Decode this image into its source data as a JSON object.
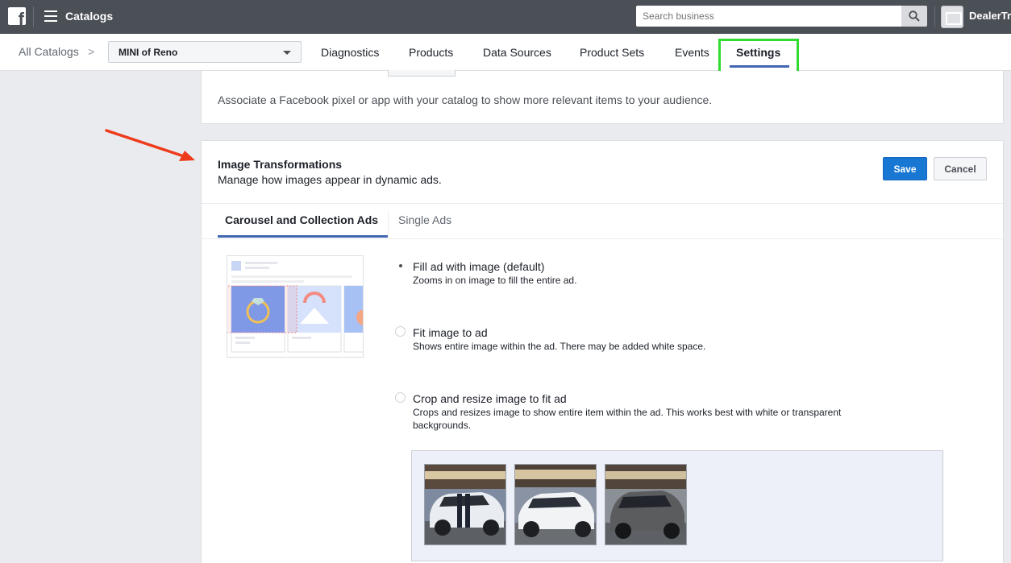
{
  "topbar": {
    "logo_letter": "f",
    "app_title": "Catalogs",
    "search_placeholder": "Search business",
    "business_name": "DealerTre"
  },
  "subnav": {
    "breadcrumb": "All Catalogs",
    "breadcrumb_sep": ">",
    "catalog_selected": "MINI of Reno",
    "tabs": [
      "Diagnostics",
      "Products",
      "Data Sources",
      "Product Sets",
      "Events",
      "Settings"
    ],
    "active_tab": "Settings"
  },
  "pixel_card": {
    "description": "Associate a Facebook pixel or app with your catalog to show more relevant items to your audience."
  },
  "image_transformations": {
    "title": "Image Transformations",
    "subtitle": "Manage how images appear in dynamic ads.",
    "save_label": "Save",
    "cancel_label": "Cancel",
    "tabs": [
      "Carousel and Collection Ads",
      "Single Ads"
    ],
    "options": [
      {
        "label": "Fill ad with image (default)",
        "description": "Zooms in on image to fill the entire ad.",
        "selected": true
      },
      {
        "label": "Fit image to ad",
        "description": "Shows entire image within the ad. There may be added white space.",
        "selected": false
      },
      {
        "label": "Crop and resize image to fit ad",
        "description": "Crops and resizes image to show entire item within the ad. This works best with white or transparent backgrounds.",
        "selected": false
      }
    ]
  },
  "colors": {
    "topbar": "#4b4f56",
    "accent": "#4267b2",
    "highlight_box": "#2fdc2f",
    "annotation_arrow": "#ee3b1c"
  }
}
